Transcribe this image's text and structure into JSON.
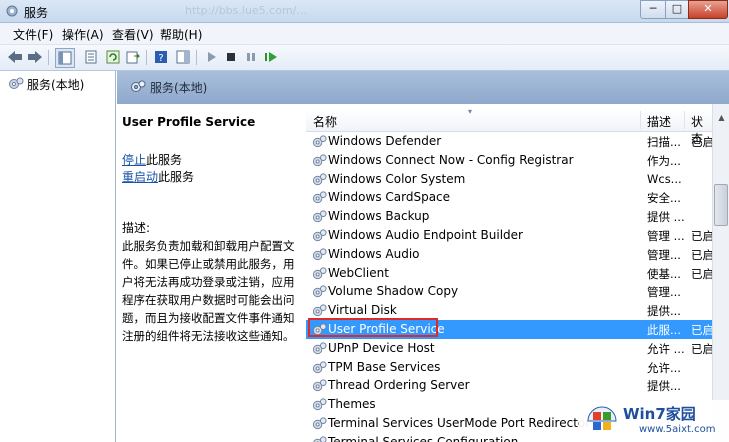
{
  "window": {
    "title": "服务",
    "title_watermark": "http://bbs.lue5.com/..."
  },
  "menu": [
    "文件(F)",
    "操作(A)",
    "查看(V)",
    "帮助(H)"
  ],
  "tree": {
    "label": "服务(本地)"
  },
  "banner": {
    "title": "服务(本地)"
  },
  "details": {
    "service_name": "User Profile Service",
    "stop_link": "停止",
    "stop_suffix": "此服务",
    "restart_link": "重启动",
    "restart_suffix": "此服务",
    "desc_label": "描述:",
    "desc_text": "此服务负责加载和卸载用户配置文件。如果已停止或禁用此服务，用户将无法再成功登录或注销，应用程序在获取用户数据时可能会出问题，而且为接收配置文件事件通知注册的组件将无法接收这些通知。"
  },
  "list": {
    "columns": {
      "name": "名称",
      "desc": "描述",
      "status": "状态"
    },
    "rows": [
      {
        "name": "Windows Defender",
        "desc": "扫描...",
        "status": "已启"
      },
      {
        "name": "Windows Connect Now - Config Registrar",
        "desc": "作为...",
        "status": ""
      },
      {
        "name": "Windows Color System",
        "desc": "Wcs...",
        "status": ""
      },
      {
        "name": "Windows CardSpace",
        "desc": "安全...",
        "status": ""
      },
      {
        "name": "Windows Backup",
        "desc": "提供 ...",
        "status": ""
      },
      {
        "name": "Windows Audio Endpoint Builder",
        "desc": "管理 ...",
        "status": "已启"
      },
      {
        "name": "Windows Audio",
        "desc": "管理...",
        "status": "已启"
      },
      {
        "name": "WebClient",
        "desc": "使基...",
        "status": "已启"
      },
      {
        "name": "Volume Shadow Copy",
        "desc": "管理...",
        "status": ""
      },
      {
        "name": "Virtual Disk",
        "desc": "提供...",
        "status": ""
      },
      {
        "name": "User Profile Service",
        "desc": "此服...",
        "status": "已启"
      },
      {
        "name": "UPnP Device Host",
        "desc": "允许 ...",
        "status": "已启"
      },
      {
        "name": "TPM Base Services",
        "desc": "允许...",
        "status": ""
      },
      {
        "name": "Thread Ordering Server",
        "desc": "提供...",
        "status": ""
      },
      {
        "name": "Themes",
        "desc": "",
        "status": ""
      },
      {
        "name": "Terminal Services UserMode Port Redirector",
        "desc": "",
        "status": ""
      },
      {
        "name": "Terminal Services Configuration",
        "desc": "",
        "status": ""
      }
    ],
    "selected_index": 10
  },
  "watermark": {
    "title": "Win7家园",
    "url": "www.5aixt.com"
  },
  "colors": {
    "selection": "#3399ff",
    "highlight_outline": "#e02a2a",
    "link": "#1a53a8"
  }
}
